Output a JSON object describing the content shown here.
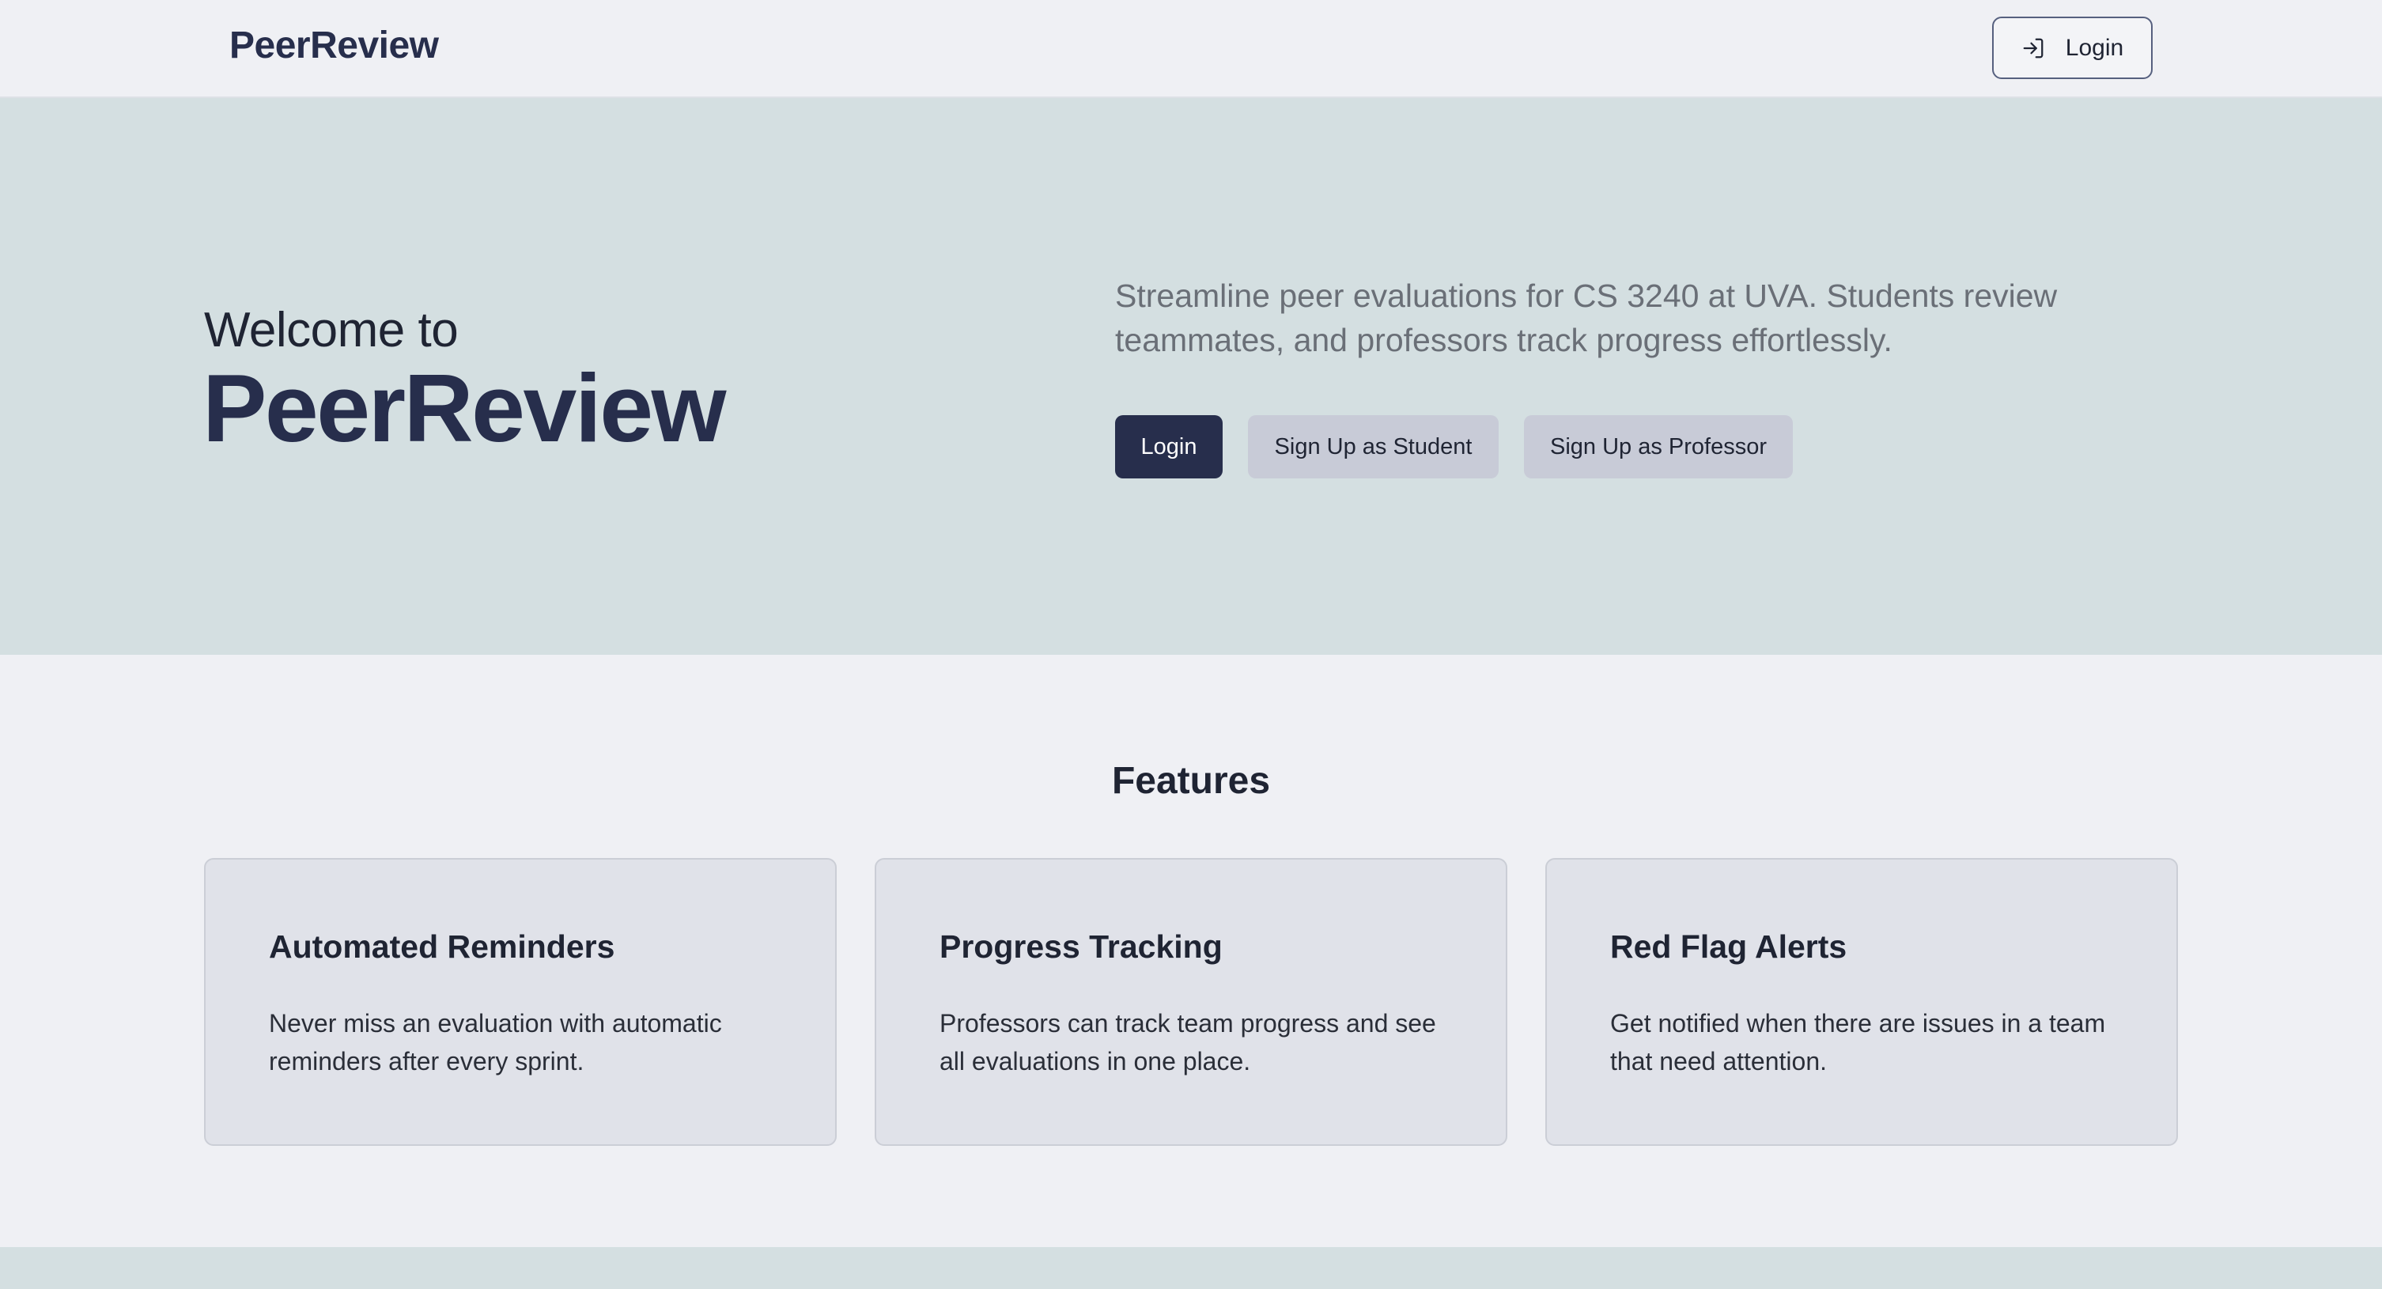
{
  "header": {
    "brand": "PeerReview",
    "login_label": "Login"
  },
  "hero": {
    "welcome": "Welcome to",
    "title": "PeerReview",
    "tagline": "Streamline peer evaluations for CS 3240 at UVA. Students review teammates, and professors track progress effortlessly.",
    "buttons": {
      "login": "Login",
      "signup_student": "Sign Up as Student",
      "signup_professor": "Sign Up as Professor"
    }
  },
  "features": {
    "heading": "Features",
    "cards": [
      {
        "title": "Automated Reminders",
        "description": "Never miss an evaluation with automatic reminders after every sprint."
      },
      {
        "title": "Progress Tracking",
        "description": "Professors can track team progress and see all evaluations in one place."
      },
      {
        "title": "Red Flag Alerts",
        "description": "Get notified when there are issues in a team that need attention."
      }
    ]
  },
  "colors": {
    "brand_navy": "#272e4c",
    "hero_bg": "#d4dfe1",
    "page_bg": "#eff0f4",
    "card_bg": "#e0e2e9",
    "secondary_button": "#c8cbd7"
  },
  "icons": {
    "header_login": "login-arrow-icon"
  }
}
